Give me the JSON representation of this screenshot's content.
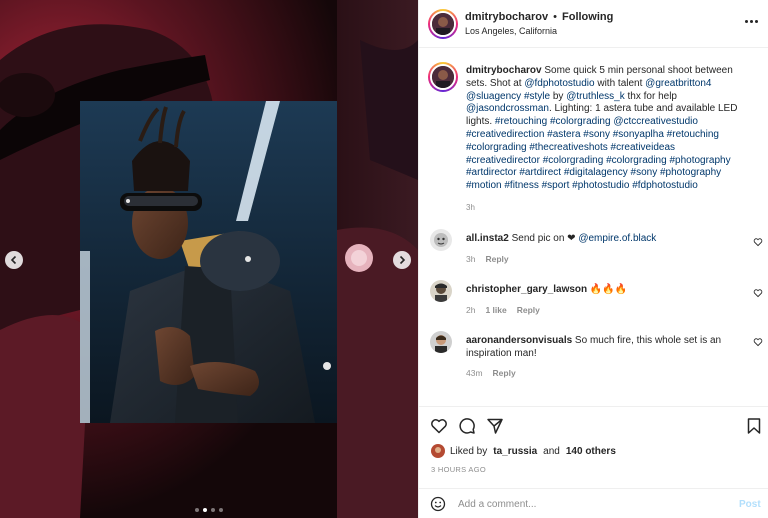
{
  "post": {
    "username": "dmitrybocharov",
    "separator": "•",
    "follow_status": "Following",
    "location": "Los Angeles, California",
    "more_icon": "more-horizontal-icon"
  },
  "caption": {
    "username": "dmitrybocharov",
    "segments": [
      {
        "t": " Some quick 5 min personal shoot between sets. Shot at "
      },
      {
        "t": "@fdphotostudio",
        "link": true
      },
      {
        "t": " with talent "
      },
      {
        "t": "@greatbritton4",
        "link": true
      },
      {
        "t": " "
      },
      {
        "t": "@sluagency",
        "link": true
      },
      {
        "t": " "
      },
      {
        "t": "#style",
        "link": true
      },
      {
        "t": " by "
      },
      {
        "t": "@truthless_k",
        "link": true
      },
      {
        "t": " thx for help "
      },
      {
        "t": "@jasondcrossman",
        "link": true
      },
      {
        "t": ". Lighting: 1 astera tube and available LED lights. "
      },
      {
        "t": "#retouching #colorgrading @ctccreativestudio #creativedirection #astera #sony #sonyaplha #retouching #colorgrading #thecreativeshots #creativeideas #creativedirector #colorgrading #colorgrading #photography #artdirector #artdirect #digitalagency #sony #photography #motion #fitness #sport #photostudio #fdphotostudio",
        "link": true
      }
    ],
    "time": "3h"
  },
  "comments": [
    {
      "username": "all.insta2",
      "pre": " Send pic on ❤ ",
      "mention": "@empire.of.black",
      "post": "",
      "time": "3h",
      "likes": "",
      "reply": "Reply"
    },
    {
      "username": "christopher_gary_lawson",
      "pre": " 🔥🔥🔥",
      "mention": "",
      "post": "",
      "time": "2h",
      "likes": "1 like",
      "reply": "Reply"
    },
    {
      "username": "aaronandersonvisuals",
      "pre": " So much fire, this whole set is an inspiration man!",
      "mention": "",
      "post": "",
      "time": "43m",
      "likes": "",
      "reply": "Reply"
    }
  ],
  "likes": {
    "prefix": "Liked by",
    "user": "ta_russia",
    "conj": "and",
    "others": "140 others"
  },
  "posted_ago": "3 HOURS AGO",
  "add_comment": {
    "placeholder": "Add a comment...",
    "post_label": "Post"
  },
  "carousel": {
    "current_index": 2,
    "total": 4
  },
  "colors": {
    "link": "#00376b",
    "muted": "#8e8e8e",
    "post_disabled": "#b2dffc"
  }
}
